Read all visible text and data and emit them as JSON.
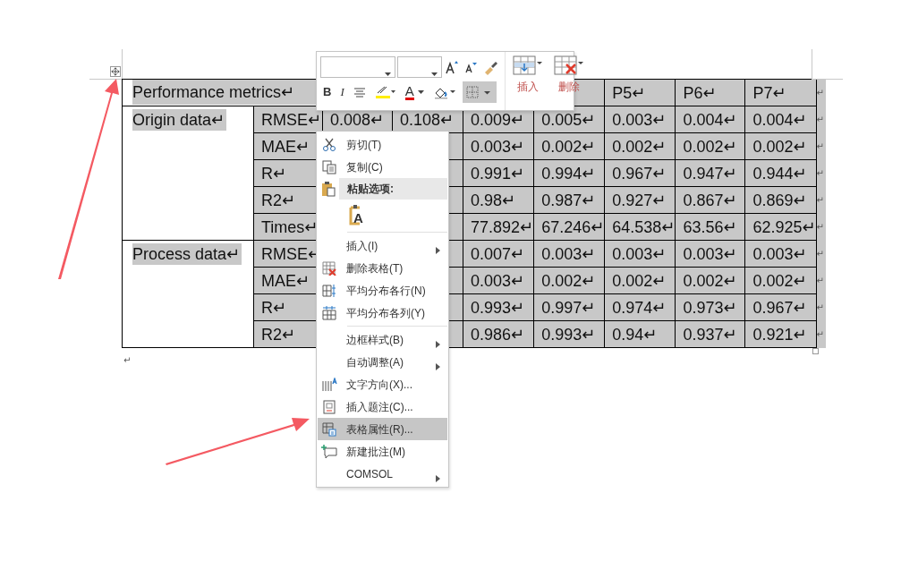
{
  "table": {
    "header": {
      "label": "Performance metrics↵",
      "columns": [
        "P5↵",
        "P6↵",
        "P7↵"
      ],
      "end_mark": "↵"
    },
    "groups": [
      {
        "label": "Origin data↵",
        "rows": [
          {
            "metric": "RMSE↵",
            "values": [
              "0.008↵",
              "0.108↵",
              "0.009↵",
              "0.005↵",
              "0.003↵",
              "0.004↵",
              "0.004↵"
            ],
            "end_mark": "↵"
          },
          {
            "metric": "MAE↵",
            "values": [
              "0.003↵",
              "0.002↵",
              "0.002↵",
              "0.002↵",
              "0.002↵"
            ],
            "end_mark": "↵"
          },
          {
            "metric": "R↵",
            "values": [
              "0.991↵",
              "0.994↵",
              "0.967↵",
              "0.947↵",
              "0.944↵"
            ],
            "end_mark": "↵"
          },
          {
            "metric": "R2↵",
            "values": [
              "0.98↵",
              "0.987↵",
              "0.927↵",
              "0.867↵",
              "0.869↵"
            ],
            "end_mark": "↵"
          },
          {
            "metric": "Times↵",
            "values": [
              "77.892↵",
              "67.246↵",
              "64.538↵",
              "63.56↵",
              "62.925↵"
            ],
            "end_mark": "↵"
          }
        ]
      },
      {
        "label": "Process data↵",
        "rows": [
          {
            "metric": "RMSE↵",
            "values": [
              "0.007↵",
              "0.003↵",
              "0.003↵",
              "0.003↵",
              "0.003↵"
            ],
            "end_mark": "↵"
          },
          {
            "metric": "MAE↵",
            "values": [
              "0.003↵",
              "0.002↵",
              "0.002↵",
              "0.002↵",
              "0.002↵"
            ],
            "end_mark": "↵"
          },
          {
            "metric": "R↵",
            "values": [
              "0.993↵",
              "0.997↵",
              "0.974↵",
              "0.973↵",
              "0.967↵"
            ],
            "end_mark": "↵"
          },
          {
            "metric": "R2↵",
            "values": [
              "0.986↵",
              "0.993↵",
              "0.94↵",
              "0.937↵",
              "0.921↵"
            ],
            "end_mark": "↵"
          }
        ]
      }
    ],
    "after_mark": "↵"
  },
  "mini_toolbar": {
    "bold": "B",
    "italic": "I",
    "font_color_letter": "A",
    "insert_label": "插入",
    "delete_label": "删除",
    "borders_selected": true
  },
  "context_menu": [
    {
      "kind": "item",
      "label": "剪切(T)",
      "selected": false
    },
    {
      "kind": "item",
      "label": "复制(C)",
      "selected": false
    },
    {
      "kind": "heading",
      "label": "粘贴选项:",
      "selected": false
    },
    {
      "kind": "paste-option",
      "label": "A",
      "selected": false
    },
    {
      "kind": "item",
      "label": "插入(I)",
      "submenu": true,
      "separator_before": true,
      "selected": false
    },
    {
      "kind": "item",
      "label": "删除表格(T)",
      "selected": false
    },
    {
      "kind": "item",
      "label": "平均分布各行(N)",
      "selected": false
    },
    {
      "kind": "item",
      "label": "平均分布各列(Y)",
      "selected": false
    },
    {
      "kind": "item",
      "label": "边框样式(B)",
      "submenu": true,
      "separator_before": true,
      "selected": false
    },
    {
      "kind": "item",
      "label": "自动调整(A)",
      "submenu": true,
      "selected": false
    },
    {
      "kind": "item",
      "label": "文字方向(X)...",
      "selected": false
    },
    {
      "kind": "item",
      "label": "插入题注(C)...",
      "selected": false
    },
    {
      "kind": "item",
      "label": "表格属性(R)...",
      "selected": true
    },
    {
      "kind": "item",
      "label": "新建批注(M)",
      "selected": false
    },
    {
      "kind": "item",
      "label": "COMSOL",
      "submenu": true,
      "selected": false
    }
  ]
}
